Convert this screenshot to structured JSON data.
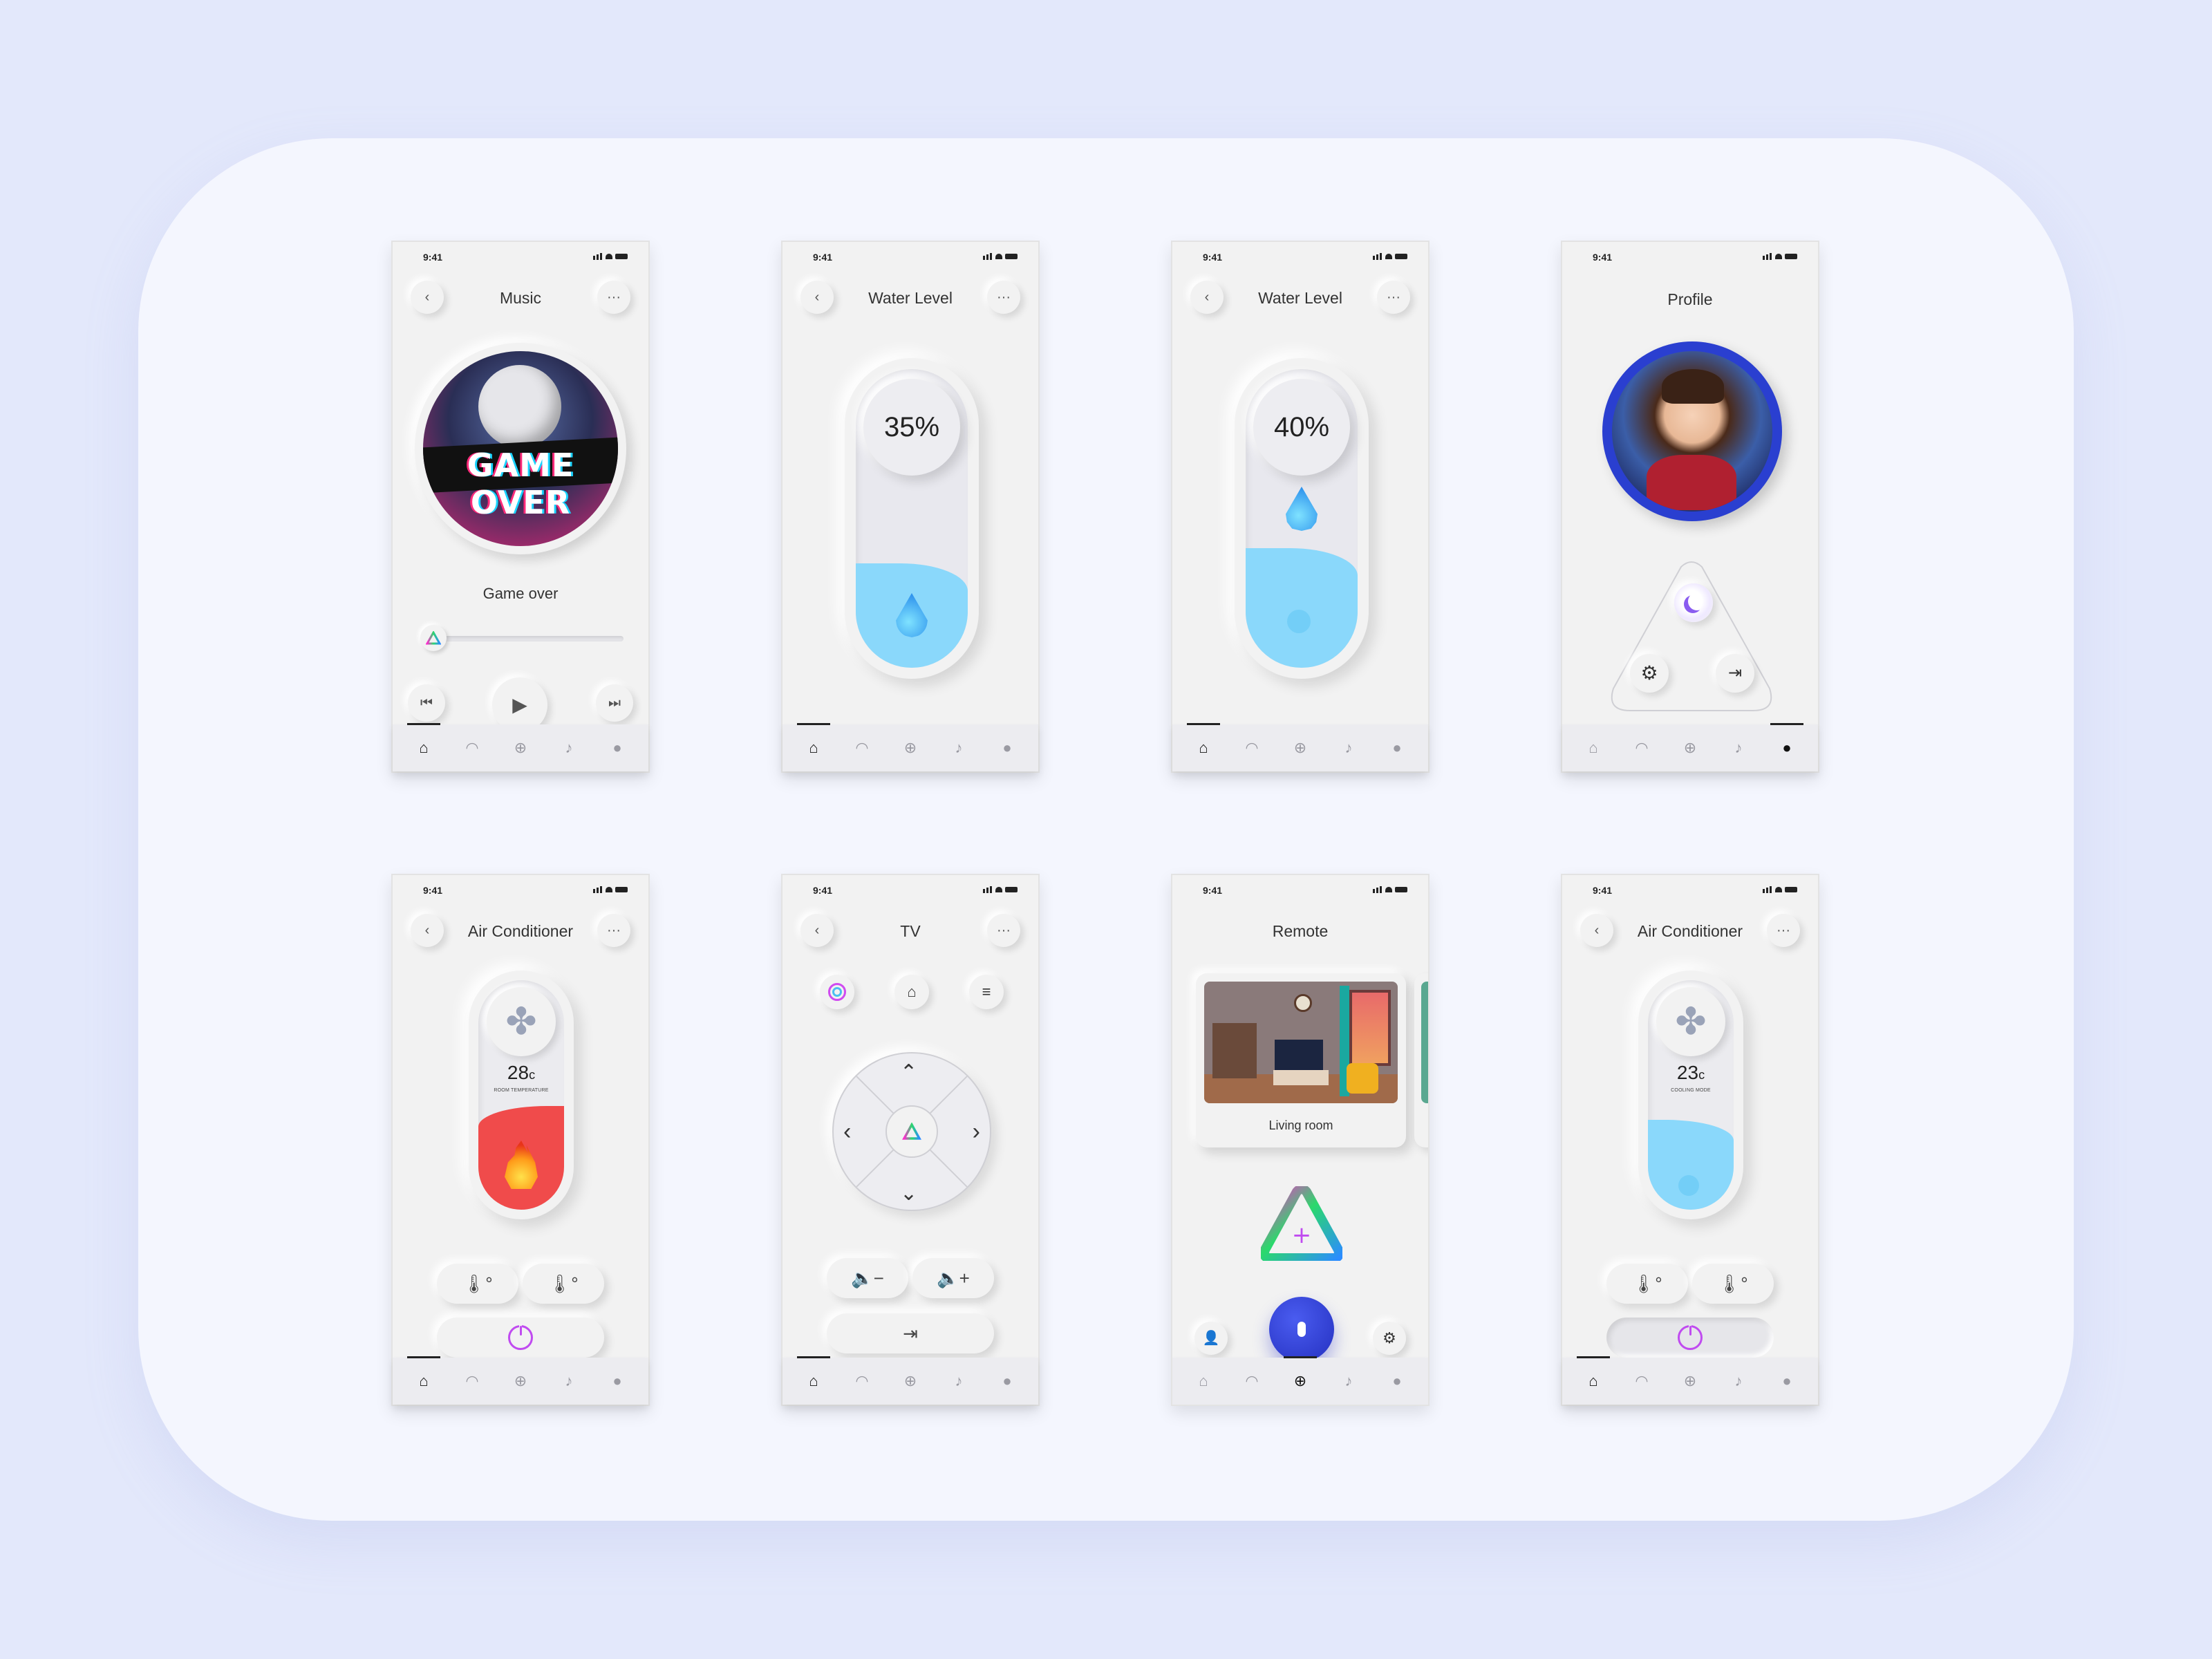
{
  "status_time": "9:41",
  "tabs": [
    "home-icon",
    "wifi-icon",
    "add-icon",
    "bell-icon",
    "user-icon"
  ],
  "music": {
    "title": "Music",
    "album_text": "GAME OVER",
    "track": "Game over",
    "progress": 0.05
  },
  "water1": {
    "title": "Water Level",
    "percent": "35%",
    "level": 0.35
  },
  "water2": {
    "title": "Water Level",
    "percent": "40%",
    "level": 0.4
  },
  "profile": {
    "title": "Profile",
    "buttons": [
      "moon-icon",
      "gear-icon",
      "exit-icon"
    ]
  },
  "ac1": {
    "title": "Air Conditioner",
    "temp": "28",
    "unit": "c",
    "mode": "ROOM TEMPERATURE"
  },
  "tv": {
    "title": "TV"
  },
  "remote": {
    "title": "Remote",
    "room": "Living room"
  },
  "ac2": {
    "title": "Air Conditioner",
    "temp": "23",
    "unit": "c",
    "mode": "COOLING MODE"
  },
  "colors": {
    "accent": "#2a3fd0",
    "water": "#8ad8fb",
    "fire": "#f04b4b",
    "bg": "#f2f2f2"
  }
}
